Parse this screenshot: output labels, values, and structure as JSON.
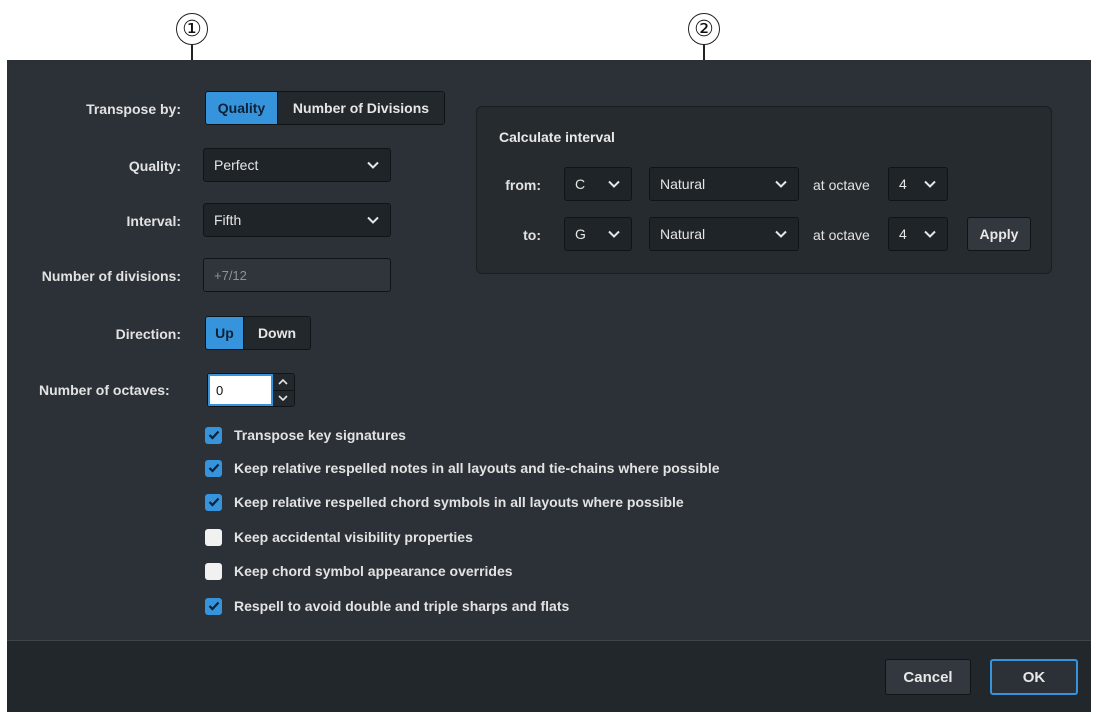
{
  "callouts": [
    "①",
    "②"
  ],
  "transpose_by": {
    "label": "Transpose by:",
    "options": [
      "Quality",
      "Number of Divisions"
    ],
    "selected": "Quality"
  },
  "quality": {
    "label": "Quality:",
    "value": "Perfect"
  },
  "interval": {
    "label": "Interval:",
    "value": "Fifth"
  },
  "divisions": {
    "label": "Number of divisions:",
    "value": "+7/12"
  },
  "direction": {
    "label": "Direction:",
    "options": [
      "Up",
      "Down"
    ],
    "selected": "Up"
  },
  "octaves": {
    "label": "Number of octaves:",
    "value": "0"
  },
  "checkboxes": [
    {
      "label": "Transpose key signatures",
      "checked": true
    },
    {
      "label": "Keep relative respelled notes in all layouts and tie-chains where possible",
      "checked": true
    },
    {
      "label": "Keep relative respelled chord symbols in all layouts where possible",
      "checked": true
    },
    {
      "label": "Keep accidental visibility properties",
      "checked": false
    },
    {
      "label": "Keep chord symbol appearance overrides",
      "checked": false
    },
    {
      "label": "Respell to avoid double and triple sharps and flats",
      "checked": true
    }
  ],
  "calculate": {
    "title": "Calculate interval",
    "from": {
      "label": "from:",
      "note": "C",
      "accidental": "Natural",
      "octave_label": "at octave",
      "octave": "4"
    },
    "to": {
      "label": "to:",
      "note": "G",
      "accidental": "Natural",
      "octave_label": "at octave",
      "octave": "4"
    },
    "apply_label": "Apply"
  },
  "footer": {
    "cancel_label": "Cancel",
    "ok_label": "OK"
  },
  "colors": {
    "accent": "#3594dc",
    "dialog_bg": "#2b3136",
    "footer_bg": "#22272b"
  },
  "icons": {
    "dropdown": "chevron-down-icon",
    "checkbox": "checkmark-icon",
    "stepper": "stepper-arrows-icon"
  }
}
